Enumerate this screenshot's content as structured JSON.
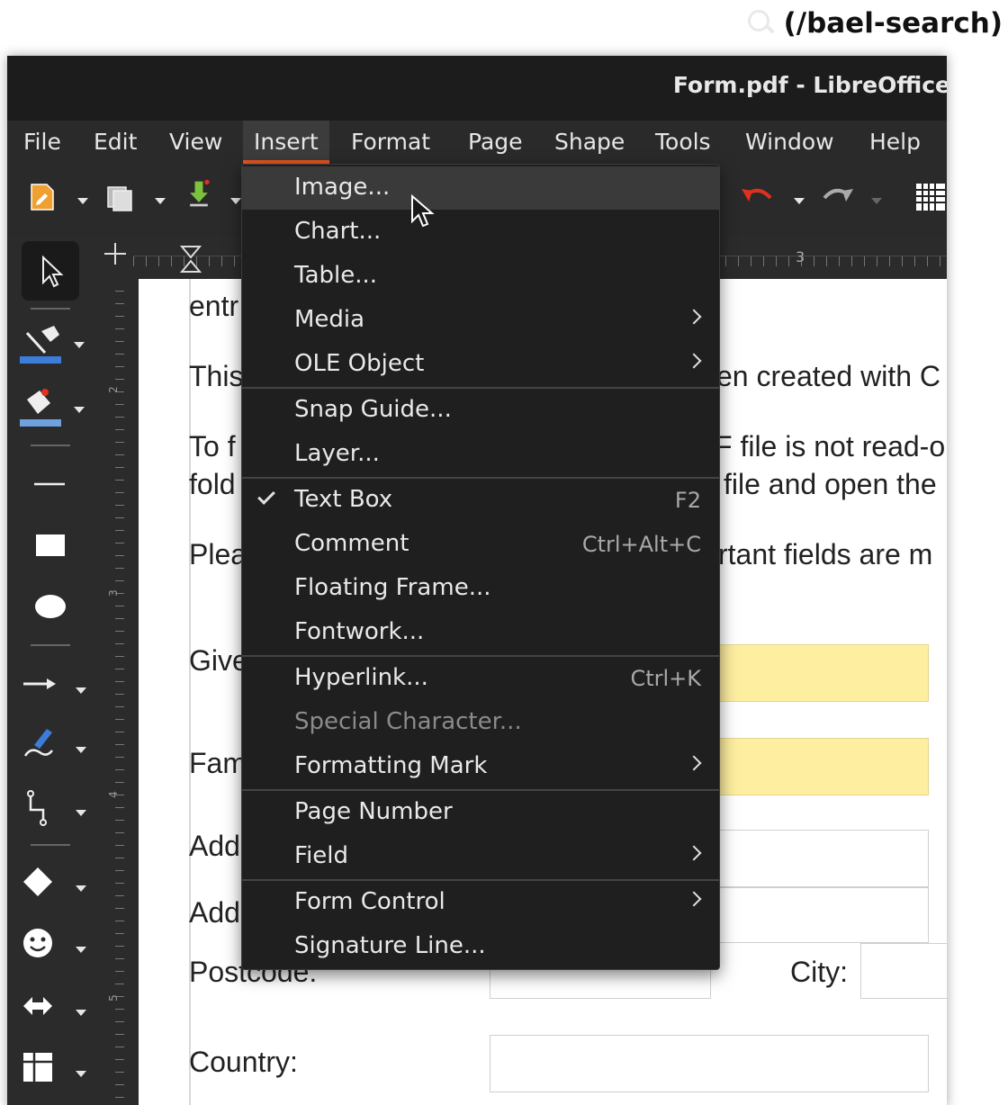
{
  "web": {
    "link_text": "(/bael-search)"
  },
  "window": {
    "title": "Form.pdf - LibreOffice"
  },
  "menubar": {
    "items": [
      {
        "label": "File"
      },
      {
        "label": "Edit"
      },
      {
        "label": "View"
      },
      {
        "label": "Insert"
      },
      {
        "label": "Format"
      },
      {
        "label": "Page"
      },
      {
        "label": "Shape"
      },
      {
        "label": "Tools"
      },
      {
        "label": "Window"
      },
      {
        "label": "Help"
      }
    ]
  },
  "insert_menu": {
    "items": [
      {
        "label": "Image...",
        "shortcut": ""
      },
      {
        "label": "Chart...",
        "shortcut": ""
      },
      {
        "label": "Table...",
        "shortcut": ""
      },
      {
        "label": "Media",
        "shortcut": ""
      },
      {
        "label": "OLE Object",
        "shortcut": ""
      },
      {
        "label": "Snap Guide...",
        "shortcut": ""
      },
      {
        "label": "Layer...",
        "shortcut": ""
      },
      {
        "label": "Text Box",
        "shortcut": "F2"
      },
      {
        "label": "Comment",
        "shortcut": "Ctrl+Alt+C"
      },
      {
        "label": "Floating Frame...",
        "shortcut": ""
      },
      {
        "label": "Fontwork...",
        "shortcut": ""
      },
      {
        "label": "Hyperlink...",
        "shortcut": "Ctrl+K"
      },
      {
        "label": "Special Character...",
        "shortcut": ""
      },
      {
        "label": "Formatting Mark",
        "shortcut": ""
      },
      {
        "label": "Page Number",
        "shortcut": ""
      },
      {
        "label": "Field",
        "shortcut": ""
      },
      {
        "label": "Form Control",
        "shortcut": ""
      },
      {
        "label": "Signature Line...",
        "shortcut": ""
      }
    ]
  },
  "document": {
    "lines": [
      "entr",
      "This",
      "en created with C",
      "To f",
      "F file is not read-o",
      "fold",
      "file and open the",
      "Plea",
      "rtant fields are m",
      "Give",
      "Fam",
      "Add",
      "Add",
      "Postcode:",
      "City:",
      "Country:"
    ]
  },
  "ruler": {
    "h_mark": "3",
    "v_marks": [
      "2",
      "3",
      "4",
      "5"
    ]
  },
  "colors": {
    "accent": "#e95420",
    "field_yellow": "#fdeea0",
    "undo_red": "#e0301e"
  }
}
